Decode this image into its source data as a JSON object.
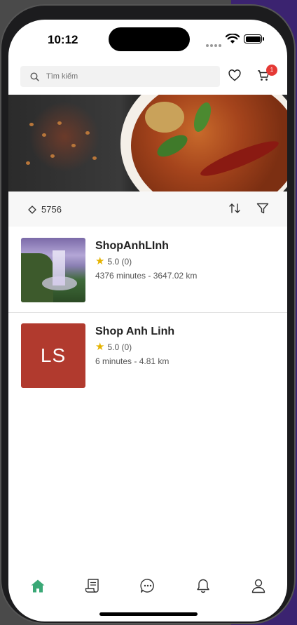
{
  "status_bar": {
    "time": "10:12"
  },
  "header": {
    "search_placeholder": "Tìm kiếm",
    "cart_badge": "1"
  },
  "filter_bar": {
    "location_count": "5756"
  },
  "shops": [
    {
      "name": "ShopAnhLInh",
      "rating": "5.0 (0)",
      "meta": "4376 minutes - 3647.02 km",
      "thumbnail": "waterfall-photo"
    },
    {
      "name": "Shop Anh Linh",
      "initials": "LS",
      "rating": "5.0 (0)",
      "meta": "6 minutes - 4.81 km",
      "avatar_color": "#b13a2e"
    }
  ],
  "tabs": [
    {
      "icon": "home-icon",
      "active": true
    },
    {
      "icon": "orders-icon",
      "active": false
    },
    {
      "icon": "chat-icon",
      "active": false
    },
    {
      "icon": "bell-icon",
      "active": false
    },
    {
      "icon": "profile-icon",
      "active": false
    }
  ],
  "colors": {
    "accent": "#3aa876",
    "badge": "#e53935",
    "star": "#e5b300"
  }
}
